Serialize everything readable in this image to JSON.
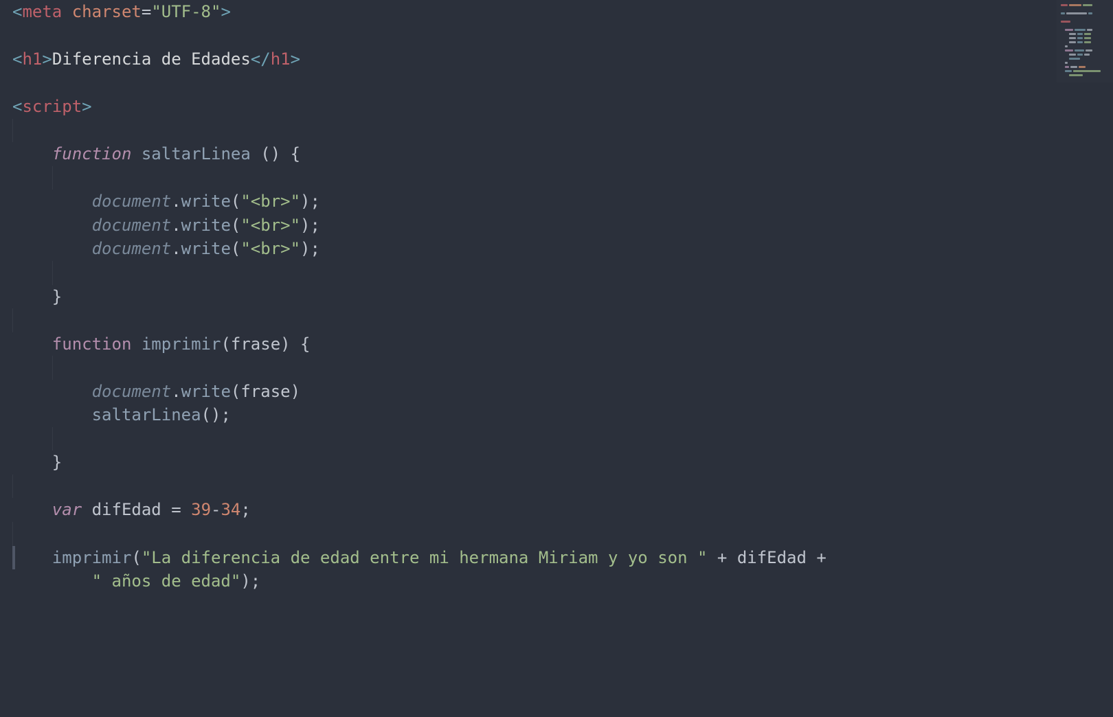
{
  "code": {
    "l1": {
      "tag": "meta",
      "attr": "charset",
      "eq": "=",
      "val": "\"UTF-8\"",
      "close": ">"
    },
    "l2": {
      "open": "<",
      "tag": "h1",
      "gt": ">",
      "text": "Diferencia de Edades",
      "open2": "</",
      "gt2": ">"
    },
    "l3": {
      "open": "<",
      "tag": "script",
      "gt": ">"
    },
    "l4": {
      "kw": "function",
      "sp": " ",
      "name": "saltarLinea",
      "rest": " () {"
    },
    "l5": {
      "obj": "document",
      "dot": ".",
      "method": "write",
      "open": "(",
      "str": "\"<br>\"",
      "close": ");"
    },
    "l6": {
      "obj": "document",
      "dot": ".",
      "method": "write",
      "open": "(",
      "str": "\"<br>\"",
      "close": ");"
    },
    "l7": {
      "obj": "document",
      "dot": ".",
      "method": "write",
      "open": "(",
      "str": "\"<br>\"",
      "close": ");"
    },
    "l8": {
      "brace": "}"
    },
    "l9": {
      "kw": "function",
      "sp": " ",
      "name": "imprimir",
      "open": "(",
      "param": "frase",
      "close": ") {"
    },
    "l10": {
      "obj": "document",
      "dot": ".",
      "method": "write",
      "open": "(",
      "arg": "frase",
      "close": ")"
    },
    "l11": {
      "call": "saltarLinea",
      "rest": "();"
    },
    "l12": {
      "brace": "}"
    },
    "l13": {
      "kw": "var",
      "sp": " ",
      "name": "difEdad",
      "eq": " = ",
      "n1": "39",
      "minus": "-",
      "n2": "34",
      "semi": ";"
    },
    "l14a": {
      "call": "imprimir",
      "open": "(",
      "str": "\"La diferencia de edad entre mi hermana Miriam y yo son \"",
      "plus": " + ",
      "ident": "difEdad",
      "plus2": " +"
    },
    "l14b": {
      "str": "\" años de edad\"",
      "close": ");"
    }
  }
}
